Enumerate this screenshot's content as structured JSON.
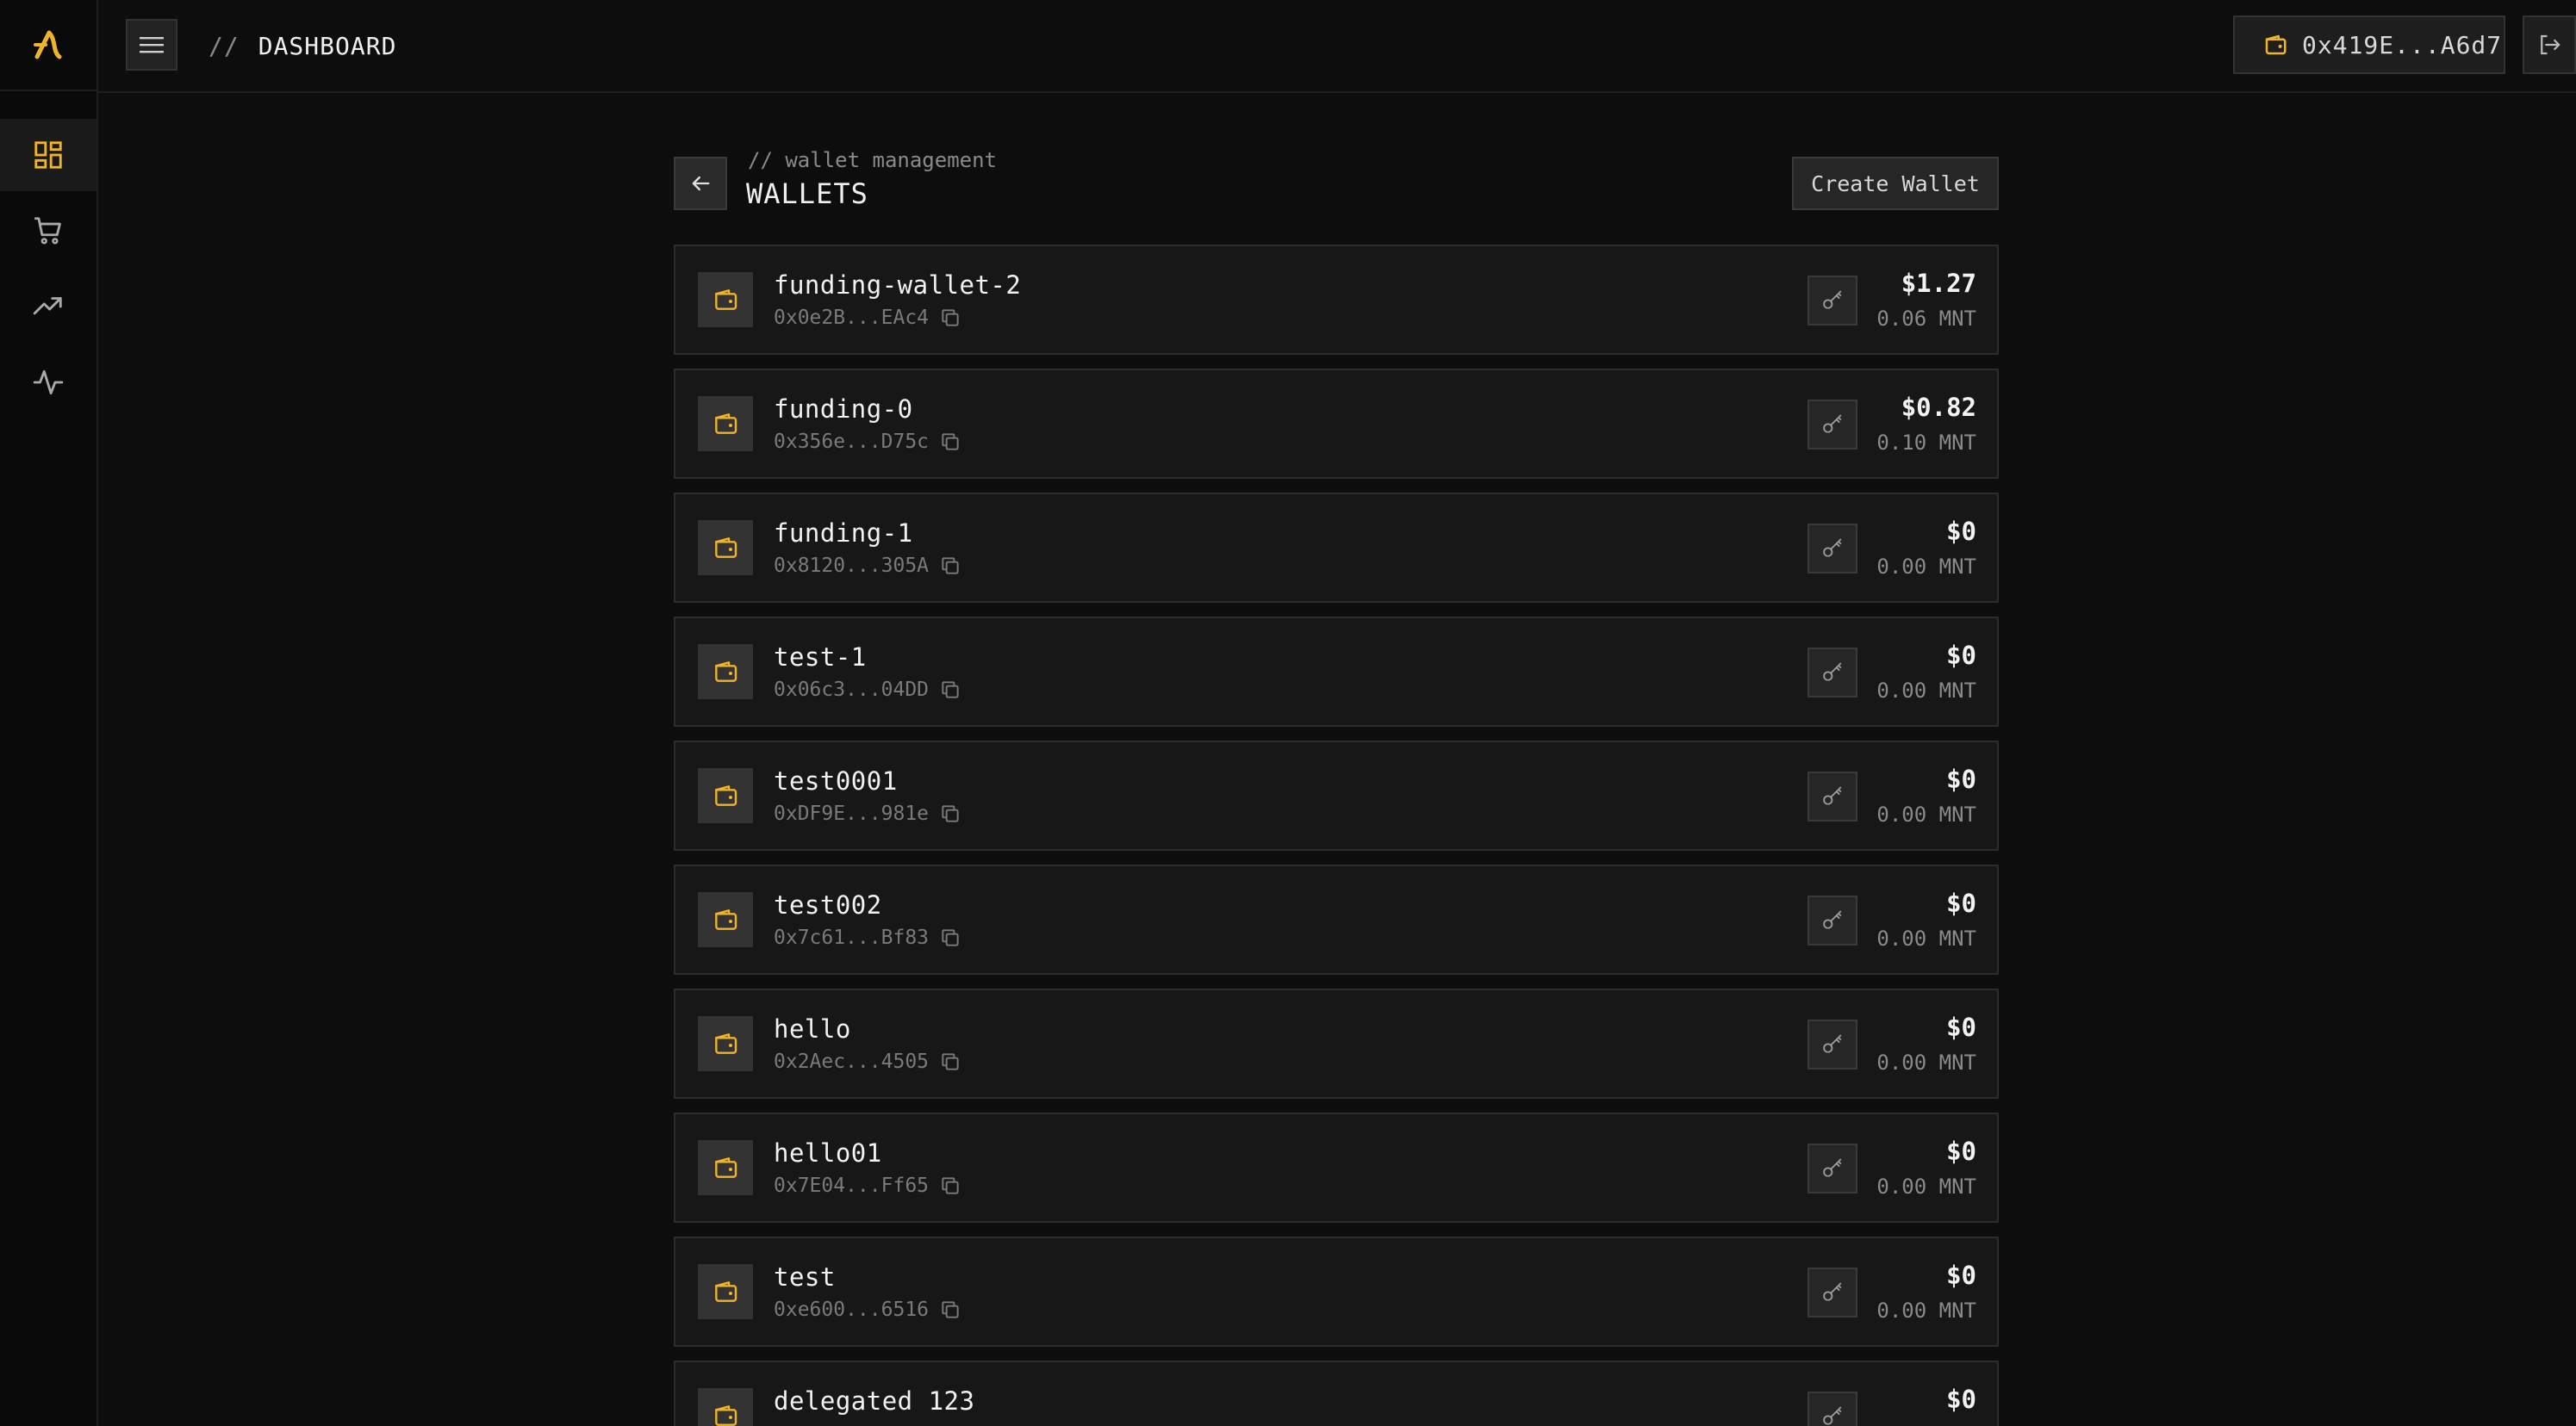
{
  "header": {
    "breadcrumb_slashes": "//",
    "breadcrumb_title": "DASHBOARD",
    "account_address": "0x419E...A6d7"
  },
  "sidebar": {
    "items": [
      {
        "icon": "dashboard-grid-icon",
        "active": true
      },
      {
        "icon": "cart-icon",
        "active": false
      },
      {
        "icon": "trending-up-icon",
        "active": false
      },
      {
        "icon": "activity-pulse-icon",
        "active": false
      }
    ]
  },
  "page": {
    "sub_label": "// wallet management",
    "title": "WALLETS",
    "create_button": "Create Wallet"
  },
  "colors": {
    "accent": "#f0b429",
    "background": "#0d0d0d",
    "card": "#171717"
  },
  "wallets": [
    {
      "name": "funding-wallet-2",
      "address": "0x0e2B...EAc4",
      "usd": "$1.27",
      "mnt": "0.06 MNT"
    },
    {
      "name": "funding-0",
      "address": "0x356e...D75c",
      "usd": "$0.82",
      "mnt": "0.10 MNT"
    },
    {
      "name": "funding-1",
      "address": "0x8120...305A",
      "usd": "$0",
      "mnt": "0.00 MNT"
    },
    {
      "name": "test-1",
      "address": "0x06c3...04DD",
      "usd": "$0",
      "mnt": "0.00 MNT"
    },
    {
      "name": "test0001",
      "address": "0xDF9E...981e",
      "usd": "$0",
      "mnt": "0.00 MNT"
    },
    {
      "name": "test002",
      "address": "0x7c61...Bf83",
      "usd": "$0",
      "mnt": "0.00 MNT"
    },
    {
      "name": "hello",
      "address": "0x2Aec...4505",
      "usd": "$0",
      "mnt": "0.00 MNT"
    },
    {
      "name": "hello01",
      "address": "0x7E04...Ff65",
      "usd": "$0",
      "mnt": "0.00 MNT"
    },
    {
      "name": "test",
      "address": "0xe600...6516",
      "usd": "$0",
      "mnt": "0.00 MNT"
    },
    {
      "name": "delegated 123",
      "address": "",
      "usd": "$0",
      "mnt": ""
    }
  ]
}
